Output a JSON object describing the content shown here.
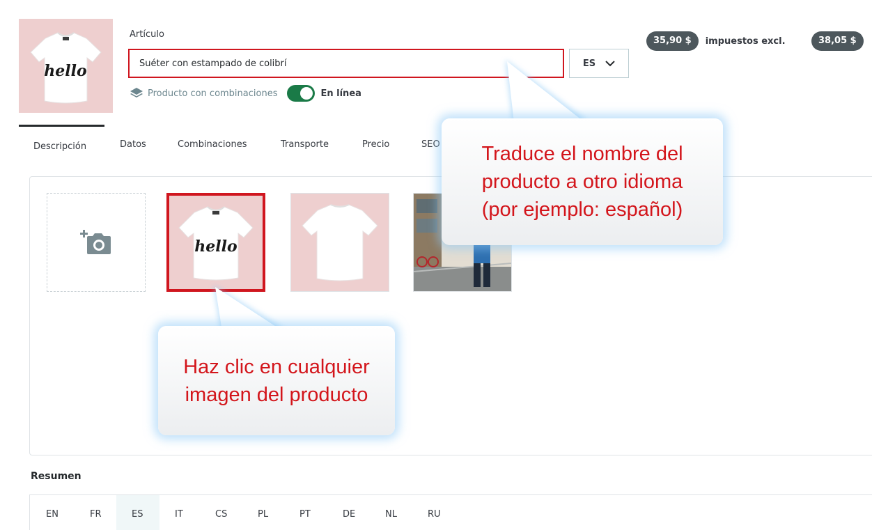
{
  "header": {
    "article_label": "Artículo",
    "product_name": "Suéter con estampado de colibrí",
    "language_selected": "ES",
    "combinations_label": "Producto con combinaciones",
    "online_label": "En línea",
    "online_enabled": true,
    "price_tax_excl": "35,90 $",
    "tax_excl_label": "impuestos excl.",
    "price_tax_incl": "38,05 $",
    "thumbnail_text": "hello"
  },
  "tabs": [
    "Descripción",
    "Datos",
    "Combinaciones",
    "Transporte",
    "Precio",
    "SEO"
  ],
  "active_tab": "Descripción",
  "images": {
    "upload_icon": "add-photo-icon",
    "items": [
      {
        "name": "tshirt-front-hello",
        "text": "hello",
        "selected": true
      },
      {
        "name": "tshirt-back",
        "selected": false
      },
      {
        "name": "street-photo",
        "selected": false
      }
    ]
  },
  "summary": {
    "title": "Resumen",
    "languages": [
      "EN",
      "FR",
      "ES",
      "IT",
      "CS",
      "PL",
      "PT",
      "DE",
      "NL",
      "RU"
    ],
    "active_language": "ES"
  },
  "callouts": {
    "translate_line1": "Traduce el nombre del",
    "translate_line2": "producto a otro idioma",
    "translate_line3": "(por ejemplo: español)",
    "click_line1": "Haz clic en cualquier",
    "click_line2": "imagen del producto"
  },
  "colors": {
    "highlight_red": "#d0161f",
    "toggle_green": "#1a7a47",
    "price_pill": "#4d575c",
    "thumb_bg": "#eecfcf",
    "callout_text": "#d3151b"
  }
}
